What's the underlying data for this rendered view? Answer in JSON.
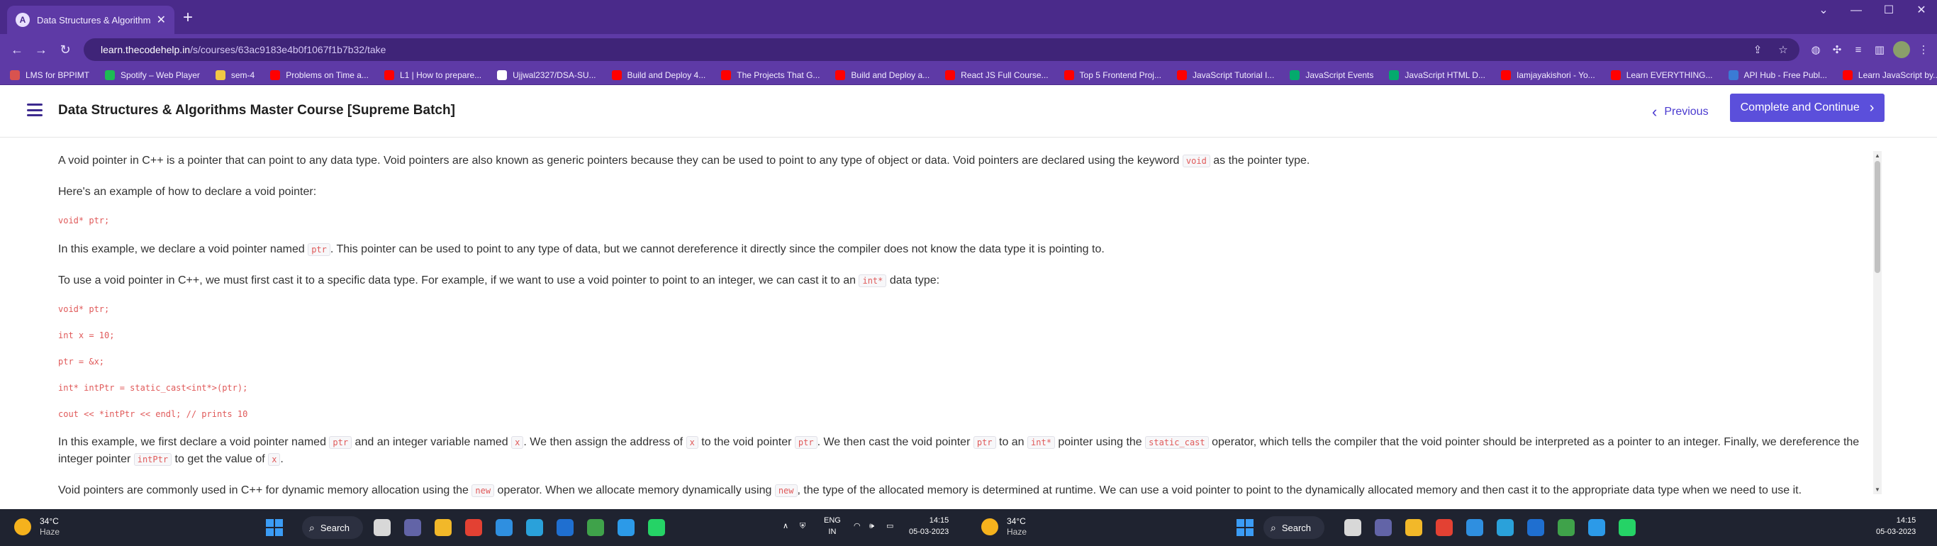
{
  "browser": {
    "tab_title": "Data Structures & Algorithms M...",
    "tab_favicon": "A",
    "url_host": "learn.thecodehelp.in",
    "url_path": "/s/courses/63ac9183e4b0f1067f1b7b32/take",
    "bookmarks": [
      {
        "label": "LMS for BPPIMT",
        "icon": "lms-icon",
        "color": "#d9534f"
      },
      {
        "label": "Spotify – Web Player",
        "icon": "spotify-icon",
        "color": "#1db954"
      },
      {
        "label": "sem-4",
        "icon": "folder-icon",
        "color": "#f2c744"
      },
      {
        "label": "Problems on Time a...",
        "icon": "youtube-icon",
        "color": "#ff0000"
      },
      {
        "label": "L1 | How to prepare...",
        "icon": "youtube-icon",
        "color": "#ff0000"
      },
      {
        "label": "Ujjwal2327/DSA-SU...",
        "icon": "github-icon",
        "color": "#ffffff"
      },
      {
        "label": "Build and Deploy 4...",
        "icon": "youtube-icon",
        "color": "#ff0000"
      },
      {
        "label": "The Projects That G...",
        "icon": "youtube-icon",
        "color": "#ff0000"
      },
      {
        "label": "Build and Deploy a...",
        "icon": "youtube-icon",
        "color": "#ff0000"
      },
      {
        "label": "React JS Full Course...",
        "icon": "youtube-icon",
        "color": "#ff0000"
      },
      {
        "label": "Top 5 Frontend Proj...",
        "icon": "youtube-icon",
        "color": "#ff0000"
      },
      {
        "label": "JavaScript Tutorial I...",
        "icon": "youtube-icon",
        "color": "#ff0000"
      },
      {
        "label": "JavaScript Events",
        "icon": "w3schools-icon",
        "color": "#04aa6d"
      },
      {
        "label": "JavaScript HTML D...",
        "icon": "w3schools-icon",
        "color": "#04aa6d"
      },
      {
        "label": "Iamjayakishori - Yo...",
        "icon": "youtube-icon",
        "color": "#ff0000"
      },
      {
        "label": "Learn EVERYTHING...",
        "icon": "youtube-icon",
        "color": "#ff0000"
      },
      {
        "label": "API Hub - Free Publ...",
        "icon": "globe-icon",
        "color": "#3a7bd5"
      },
      {
        "label": "Learn JavaScript by...",
        "icon": "youtube-icon",
        "color": "#ff0000"
      }
    ]
  },
  "course": {
    "title": "Data Structures & Algorithms Master Course [Supreme Batch]",
    "prev_label": "Previous",
    "complete_label": "Complete and Continue"
  },
  "lesson": {
    "p1_a": "A void pointer in C++ is a pointer that can point to any data type. Void pointers are also known as generic pointers because they can be used to point to any type of object or data. Void pointers are declared using the keyword ",
    "p1_code": "void",
    "p1_b": " as the pointer type.",
    "p2": "Here's an example of how to declare a void pointer:",
    "code1": "void* ptr;",
    "p3_a": "In this example, we declare a void pointer named ",
    "p3_code": "ptr",
    "p3_b": ". This pointer can be used to point to any type of data, but we cannot dereference it directly since the compiler does not know the data type it is pointing to.",
    "p4_a": "To use a void pointer in C++, we must first cast it to a specific data type. For example, if we want to use a void pointer to point to an integer, we can cast it to an ",
    "p4_code": "int*",
    "p4_b": " data type:",
    "code_block": [
      "void* ptr;",
      "int x = 10;",
      "ptr = &x;",
      "int* intPtr = static_cast<int*>(ptr);",
      "cout << *intPtr << endl; // prints 10"
    ],
    "p5_parts": [
      {
        "t": "text",
        "v": "In this example, we first declare a void pointer named "
      },
      {
        "t": "code",
        "v": "ptr"
      },
      {
        "t": "text",
        "v": " and an integer variable named "
      },
      {
        "t": "code",
        "v": "x"
      },
      {
        "t": "text",
        "v": ". We then assign the address of "
      },
      {
        "t": "code",
        "v": "x"
      },
      {
        "t": "text",
        "v": " to the void pointer "
      },
      {
        "t": "code",
        "v": "ptr"
      },
      {
        "t": "text",
        "v": ". We then cast the void pointer "
      },
      {
        "t": "code",
        "v": "ptr"
      },
      {
        "t": "text",
        "v": " to an "
      },
      {
        "t": "code",
        "v": "int*"
      },
      {
        "t": "text",
        "v": " pointer using the "
      },
      {
        "t": "code",
        "v": "static_cast"
      },
      {
        "t": "text",
        "v": " operator, which tells the compiler that the void pointer should be interpreted as a pointer to an integer. Finally, we dereference the integer pointer "
      },
      {
        "t": "code",
        "v": "intPtr"
      },
      {
        "t": "text",
        "v": " to get the value of "
      },
      {
        "t": "code",
        "v": "x"
      },
      {
        "t": "text",
        "v": "."
      }
    ],
    "p6_parts": [
      {
        "t": "text",
        "v": "Void pointers are commonly used in C++ for dynamic memory allocation using the "
      },
      {
        "t": "code",
        "v": "new"
      },
      {
        "t": "text",
        "v": " operator. When we allocate memory dynamically using "
      },
      {
        "t": "code",
        "v": "new"
      },
      {
        "t": "text",
        "v": ", the type of the allocated memory is determined at runtime. We can use a void pointer to point to the dynamically allocated memory and then cast it to the appropriate data type when we need to use it."
      }
    ]
  },
  "taskbar": {
    "temp": "34°C",
    "weather": "Haze",
    "search_label": "Search",
    "lang_top": "ENG",
    "lang_bottom": "IN",
    "time": "14:15",
    "date": "05-03-2023",
    "apps": [
      {
        "name": "task-view-icon",
        "color": "#d8d8d8"
      },
      {
        "name": "teams-icon",
        "color": "#6264a7"
      },
      {
        "name": "file-explorer-icon",
        "color": "#f2b829"
      },
      {
        "name": "chrome-icon",
        "color": "#e34133"
      },
      {
        "name": "vscode-icon",
        "color": "#2f8fe0"
      },
      {
        "name": "telegram-icon",
        "color": "#2aa1da"
      },
      {
        "name": "mail-icon",
        "color": "#1f6fd0"
      },
      {
        "name": "xbox-icon",
        "color": "#3fa24a"
      },
      {
        "name": "cortana-icon",
        "color": "#2c9ae8"
      },
      {
        "name": "whatsapp-icon",
        "color": "#25d366"
      }
    ]
  }
}
